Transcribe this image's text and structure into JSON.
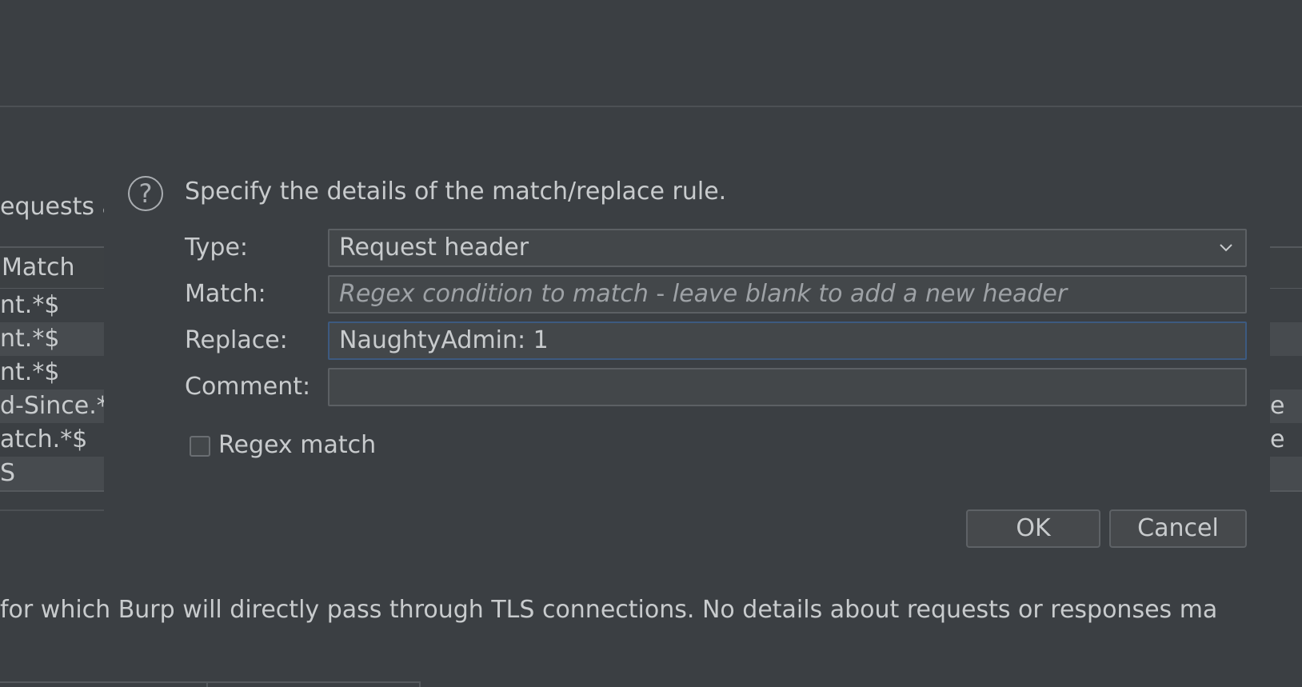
{
  "background": {
    "requests_fragment": "equests a",
    "left_table": {
      "header": "Match",
      "rows": [
        "nt.*$",
        "nt.*$",
        "nt.*$",
        "d-Since.*",
        "atch.*$",
        "S"
      ]
    },
    "right_table": {
      "rows": [
        "",
        "",
        "",
        "e",
        "e",
        ""
      ]
    },
    "footer_text": "for which Burp will directly pass through TLS connections. No details about requests or responses ma"
  },
  "dialog": {
    "message": "Specify the details of the match/replace rule.",
    "help_icon_glyph": "?",
    "type": {
      "label": "Type:",
      "value": "Request header"
    },
    "match": {
      "label": "Match:",
      "placeholder_part1": "Regex condition to match",
      "placeholder_sep": " - ",
      "placeholder_part2": "leave blank to add a new header"
    },
    "replace": {
      "label": "Replace:",
      "value": "NaughtyAdmin: 1"
    },
    "comment": {
      "label": "Comment:",
      "value": ""
    },
    "regex_match": {
      "label": "Regex match",
      "checked": false
    },
    "ok_label": "OK",
    "cancel_label": "Cancel"
  },
  "colors": {
    "background": "#3b3f43",
    "focus_border": "#3d5a80",
    "text": "#c8cbcd"
  }
}
